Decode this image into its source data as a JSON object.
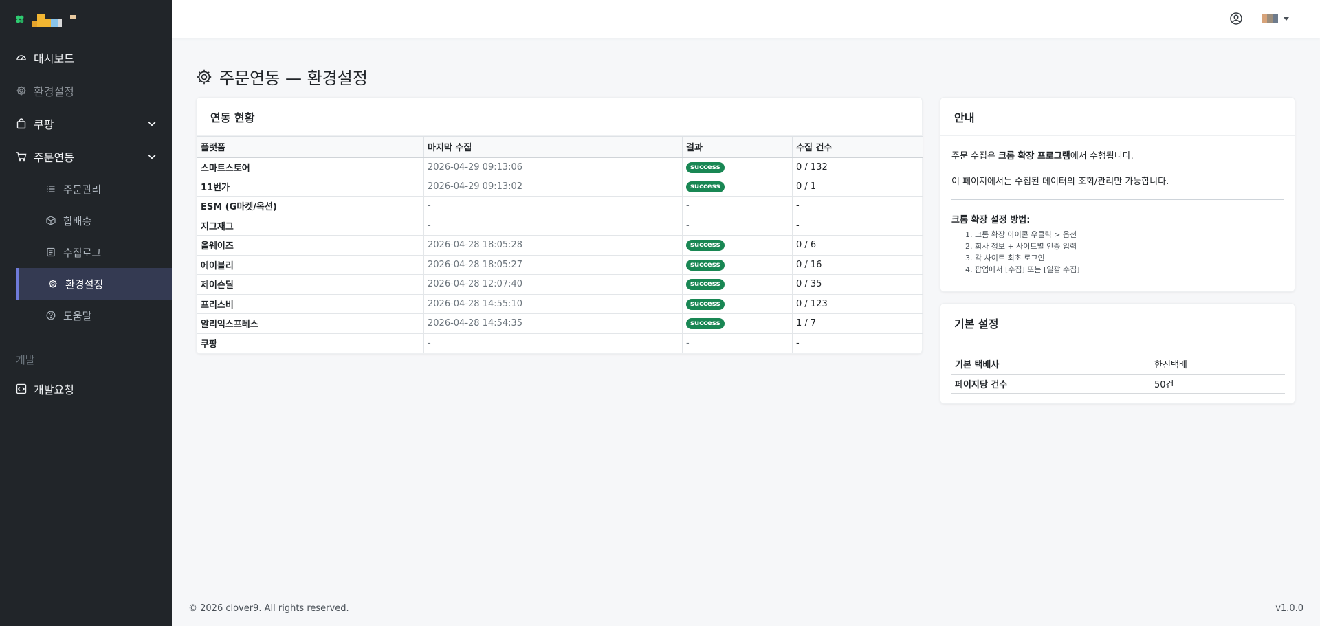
{
  "sidebar": {
    "logo_colors": [
      "#f2b632",
      "#d9d9d9",
      "#89c4ea",
      "#f2b632"
    ],
    "items": [
      {
        "label": "대시보드",
        "icon": "speedometer-icon"
      },
      {
        "label": "환경설정",
        "icon": "gear-icon"
      },
      {
        "label": "쿠팡",
        "icon": "shopping-bag-icon"
      },
      {
        "label": "주문연동",
        "icon": "cart-icon"
      }
    ],
    "subitems": [
      {
        "label": "주문관리",
        "icon": "list-icon"
      },
      {
        "label": "합배송",
        "icon": "box-icon"
      },
      {
        "label": "수집로그",
        "icon": "log-icon"
      },
      {
        "label": "환경설정",
        "icon": "gear-icon"
      },
      {
        "label": "도움말",
        "icon": "question-icon"
      }
    ],
    "section_dev": "개발",
    "dev_request": "개발요청"
  },
  "page": {
    "title": "주문연동 — 환경설정"
  },
  "status_card": {
    "title": "연동 현황",
    "columns": [
      "플랫폼",
      "마지막 수집",
      "결과",
      "수집 건수"
    ],
    "rows": [
      {
        "platform": "스마트스토어",
        "last": "2026-04-29 09:13:06",
        "result": "success",
        "count": "0 / 132"
      },
      {
        "platform": "11번가",
        "last": "2026-04-29 09:13:02",
        "result": "success",
        "count": "0 / 1"
      },
      {
        "platform": "ESM (G마켓/옥션)",
        "last": "-",
        "result": "-",
        "count": "-"
      },
      {
        "platform": "지그재그",
        "last": "-",
        "result": "-",
        "count": "-"
      },
      {
        "platform": "올웨이즈",
        "last": "2026-04-28 18:05:28",
        "result": "success",
        "count": "0 / 6"
      },
      {
        "platform": "에이블리",
        "last": "2026-04-28 18:05:27",
        "result": "success",
        "count": "0 / 16"
      },
      {
        "platform": "제이슨딜",
        "last": "2026-04-28 12:07:40",
        "result": "success",
        "count": "0 / 35"
      },
      {
        "platform": "프리스비",
        "last": "2026-04-28 14:55:10",
        "result": "success",
        "count": "0 / 123"
      },
      {
        "platform": "알리익스프레스",
        "last": "2026-04-28 14:54:35",
        "result": "success",
        "count": "1 / 7"
      },
      {
        "platform": "쿠팡",
        "last": "-",
        "result": "-",
        "count": "-"
      }
    ]
  },
  "guide_card": {
    "title": "안내",
    "line1_pre": "주문 수집은 ",
    "line1_bold": "크롬 확장 프로그램",
    "line1_post": "에서 수행됩니다.",
    "line2": "이 페이지에서는 수집된 데이터의 조회/관리만 가능합니다.",
    "steps_title": "크롬 확장 설정 방법:",
    "steps": [
      "1. 크롬 확장 아이콘 우클릭 > 옵션",
      "2. 회사 정보 + 사이트별 인증 입력",
      "3. 각 사이트 최초 로그인",
      "4. 팝업에서 [수집] 또는 [일괄 수집]"
    ]
  },
  "basic_card": {
    "title": "기본 설정",
    "rows": [
      {
        "key": "기본 택배사",
        "value": "한진택배"
      },
      {
        "key": "페이지당 건수",
        "value": "50건"
      }
    ]
  },
  "footer": {
    "copyright": "© 2026 clover9. All rights reserved.",
    "version": "v1.0.0"
  }
}
